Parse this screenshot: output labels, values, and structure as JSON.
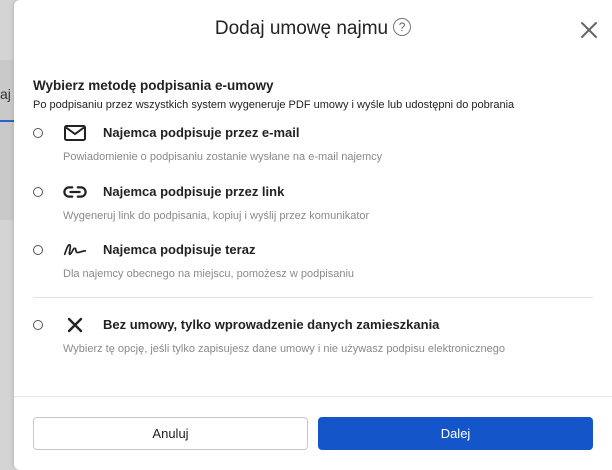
{
  "background": {
    "tab_label": "aj"
  },
  "dialog": {
    "title": "Dodaj umowę najmu",
    "help_symbol": "?",
    "heading": "Wybierz metodę podpisania e-umowy",
    "subheading": "Po podpisaniu przez wszystkich system wygeneruje PDF umowy i wyśle lub udostępni do pobrania",
    "options": [
      {
        "icon": "envelope-icon",
        "label": "Najemca podpisuje przez e-mail",
        "description": "Powiadomienie o podpisaniu zostanie wysłane na e-mail najemcy"
      },
      {
        "icon": "link-icon",
        "label": "Najemca podpisuje przez link",
        "description": "Wygeneruj link do podpisania, kopiuj i wyślij przez komunikator"
      },
      {
        "icon": "signature-icon",
        "label": "Najemca podpisuje teraz",
        "description": "Dla najemcy obecnego na miejscu, pomożesz w podpisaniu"
      },
      {
        "icon": "x-icon",
        "label": "Bez umowy, tylko wprowadzenie danych zamieszkania",
        "description": "Wybierz tę opcję, jeśli tylko zapisujesz dane umowy i nie używasz podpisu elektronicznego"
      }
    ],
    "buttons": {
      "cancel": "Anuluj",
      "next": "Dalej"
    }
  },
  "colors": {
    "primary": "#1456c9",
    "muted_text": "#8a8a8a"
  }
}
